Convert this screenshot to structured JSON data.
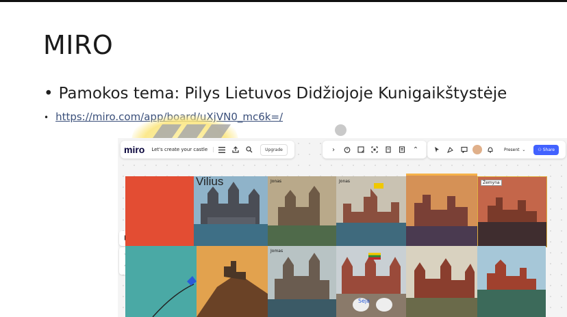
{
  "slide": {
    "title": "MIRO",
    "bullet_topic": "Pamokos tema: Pilys Lietuvos Didžiojoje Kunigaikštystėje",
    "link": "https://miro.com/app/board/uXjVN0_mc6k=/"
  },
  "miro": {
    "logo": "miro",
    "board_name": "Let's create your castle",
    "upgrade_label": "Upgrade",
    "present_label": "Present",
    "share_label": "Share",
    "toolbar_left_icons": [
      "menu-icon",
      "upload-icon",
      "search-icon"
    ],
    "toolbar_mid_icons": [
      "chevron-right-icon",
      "timer-icon",
      "sticky-note-icon",
      "frame-icon",
      "document-icon",
      "list-icon",
      "expand-icon"
    ],
    "toolbar_right_icons": [
      "cursor-arrow-icon",
      "celebrate-icon",
      "comment-icon",
      "avatar",
      "bell-icon"
    ],
    "side_tools": [
      "pointer-icon",
      "undo-icon",
      "redo-icon"
    ]
  },
  "canvas": {
    "name_label": "Vilius",
    "tiles": [
      {
        "label": ""
      },
      {
        "label": "Jonas"
      },
      {
        "label": "Jonas"
      },
      {
        "label": ""
      },
      {
        "label": "Žemyna"
      },
      {
        "label": ""
      },
      {
        "label": "Jomas"
      },
      {
        "label": ""
      },
      {
        "label": ""
      },
      {
        "label": ""
      }
    ],
    "caption": "Seja"
  },
  "colors": {
    "red_block": "#e34d33",
    "teal_block": "#4aa9a5",
    "share_blue": "#4262ff",
    "link_color": "#3a4f7a"
  }
}
